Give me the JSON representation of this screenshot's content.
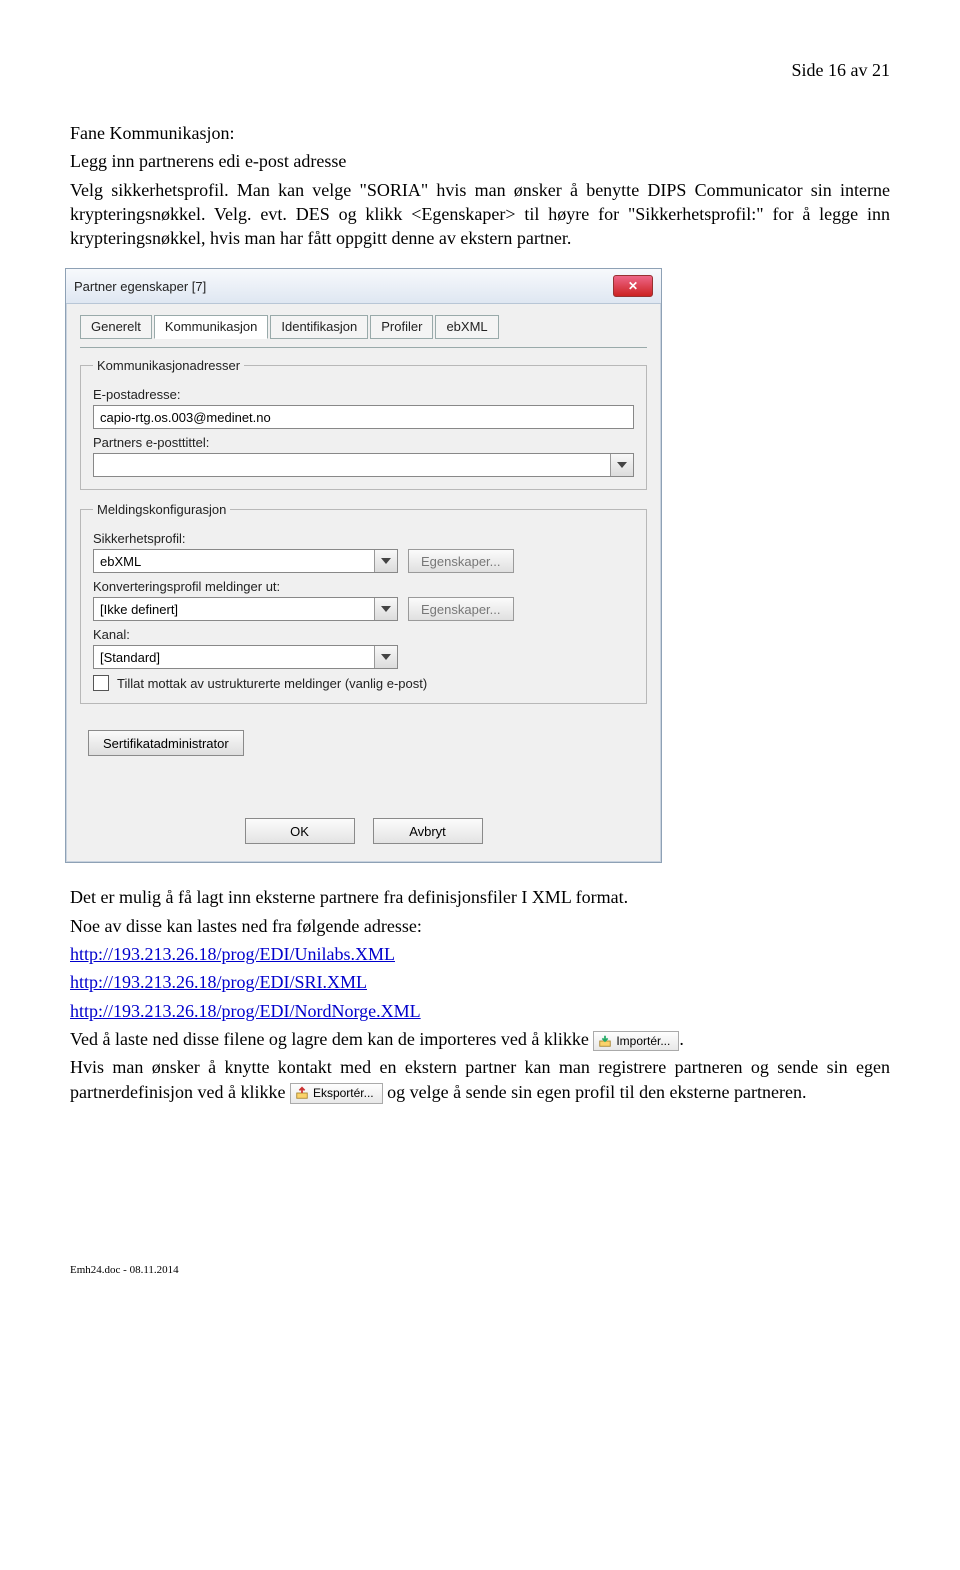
{
  "page_number": "Side 16 av 21",
  "intro": {
    "h": "Fane Kommunikasjon:",
    "l1": "Legg inn partnerens edi e-post adresse",
    "l2": "Velg sikkerhetsprofil. Man kan velge \"SORIA\" hvis man ønsker å benytte DIPS Communicator sin interne krypteringsnøkkel. Velg. evt. DES og klikk <Egenskaper> til høyre for \"Sikkerhetsprofil:\" for å legge inn krypteringsnøkkel, hvis man har fått oppgitt denne av ekstern partner."
  },
  "dialog": {
    "title": "Partner egenskaper [7]",
    "tabs": [
      "Generelt",
      "Kommunikasjon",
      "Identifikasjon",
      "Profiler",
      "ebXML"
    ],
    "group1": {
      "legend": "Kommunikasjonadresser",
      "email_label": "E-postadresse:",
      "email_value": "capio-rtg.os.003@medinet.no",
      "title_label": "Partners e-posttittel:",
      "title_value": ""
    },
    "group2": {
      "legend": "Meldingskonfigurasjon",
      "sec_label": "Sikkerhetsprofil:",
      "sec_value": "ebXML",
      "props_btn": "Egenskaper...",
      "conv_label": "Konverteringsprofil meldinger ut:",
      "conv_value": "[Ikke definert]",
      "kanal_label": "Kanal:",
      "kanal_value": "[Standard]",
      "chk_label": "Tillat mottak av ustrukturerte meldinger (vanlig e-post)"
    },
    "cert_btn": "Sertifikatadministrator",
    "ok": "OK",
    "cancel": "Avbryt"
  },
  "after": {
    "p1": "Det er mulig å få lagt inn eksterne partnere fra definisjonsfiler I XML format.",
    "p2": "Noe av disse kan lastes ned fra følgende adresse:",
    "links": [
      "http://193.213.26.18/prog/EDI/Unilabs.XML",
      "http://193.213.26.18/prog/EDI/SRI.XML",
      "http://193.213.26.18/prog/EDI/NordNorge.XML"
    ],
    "p3a": "Ved å laste ned disse filene og lagre dem kan de importeres ved å klikke ",
    "import_btn": "Importér...",
    "p3b": ".",
    "p4a": "Hvis man ønsker å knytte kontakt med en ekstern partner kan man registrere partneren og sende sin egen partnerdefinisjon ved å klikke ",
    "export_btn": "Eksportér...",
    "p4b": " og velge å sende sin egen profil til den eksterne partneren."
  },
  "footer": "Emh24.doc - 08.11.2014"
}
